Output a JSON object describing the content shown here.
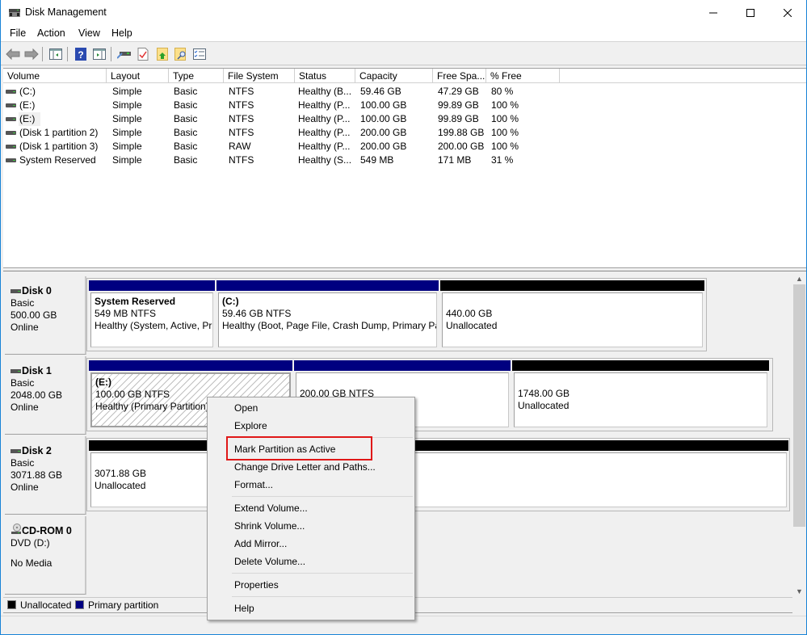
{
  "window": {
    "title": "Disk Management",
    "icon": "disk-management-icon",
    "controls": [
      "minimize",
      "maximize",
      "close"
    ]
  },
  "menubar": {
    "items": [
      {
        "label": "File"
      },
      {
        "label": "Action"
      },
      {
        "label": "View"
      },
      {
        "label": "Help"
      }
    ]
  },
  "toolbar": {
    "buttons": [
      {
        "icon": "back-arrow-icon"
      },
      {
        "icon": "forward-arrow-icon"
      },
      {
        "icon": "show-hide-console-tree-icon"
      },
      {
        "icon": "help-icon"
      },
      {
        "icon": "show-hide-action-pane-icon"
      },
      {
        "icon": "connect-drive-icon"
      },
      {
        "icon": "check-document-icon"
      },
      {
        "icon": "folder-up-icon"
      },
      {
        "icon": "folder-search-icon"
      },
      {
        "icon": "properties-list-icon"
      }
    ]
  },
  "volume_list": {
    "columns": [
      "Volume",
      "Layout",
      "Type",
      "File System",
      "Status",
      "Capacity",
      "Free Spa...",
      "% Free"
    ],
    "rows": [
      {
        "volume": " (C:)",
        "layout": "Simple",
        "type": "Basic",
        "fs": "NTFS",
        "status": "Healthy (B...",
        "capacity": "59.46 GB",
        "free": "47.29 GB",
        "pct": "80 %"
      },
      {
        "volume": " (E:)",
        "layout": "Simple",
        "type": "Basic",
        "fs": "NTFS",
        "status": "Healthy (P...",
        "capacity": "100.00 GB",
        "free": "99.89 GB",
        "pct": "100 %"
      },
      {
        "volume": " (E:)",
        "layout": "Simple",
        "type": "Basic",
        "fs": "NTFS",
        "status": "Healthy (P...",
        "capacity": "100.00 GB",
        "free": "99.89 GB",
        "pct": "100 %",
        "selected": true
      },
      {
        "volume": "(Disk 1 partition 2)",
        "layout": "Simple",
        "type": "Basic",
        "fs": "NTFS",
        "status": "Healthy (P...",
        "capacity": "200.00 GB",
        "free": "199.88 GB",
        "pct": "100 %"
      },
      {
        "volume": "(Disk 1 partition 3)",
        "layout": "Simple",
        "type": "Basic",
        "fs": "RAW",
        "status": "Healthy (P...",
        "capacity": "200.00 GB",
        "free": "200.00 GB",
        "pct": "100 %"
      },
      {
        "volume": "System Reserved",
        "layout": "Simple",
        "type": "Basic",
        "fs": "NTFS",
        "status": "Healthy (S...",
        "capacity": "549 MB",
        "free": "171 MB",
        "pct": "31 %"
      }
    ]
  },
  "disks": [
    {
      "name": "Disk 0",
      "type": "Basic",
      "size": "500.00 GB",
      "status": "Online",
      "partitions": [
        {
          "title": "System Reserved",
          "line1": "549 MB NTFS",
          "line2": "Healthy (System, Active, Pr",
          "kind": "primary"
        },
        {
          "title": " (C:)",
          "line1": "59.46 GB NTFS",
          "line2": "Healthy (Boot, Page File, Crash Dump, Primary Pa",
          "kind": "primary"
        },
        {
          "title": "",
          "line1": "440.00 GB",
          "line2": "Unallocated",
          "kind": "unallocated"
        }
      ]
    },
    {
      "name": "Disk 1",
      "type": "Basic",
      "size": "2048.00 GB",
      "status": "Online",
      "partitions": [
        {
          "title": " (E:)",
          "line1": "100.00 GB NTFS",
          "line2": "Healthy (Primary Partition)",
          "kind": "primary",
          "selected": true
        },
        {
          "title": "",
          "line1": "200.00 GB NTFS",
          "line2": "",
          "kind": "primary"
        },
        {
          "title": "",
          "line1": "1748.00 GB",
          "line2": "Unallocated",
          "kind": "unallocated"
        }
      ]
    },
    {
      "name": "Disk 2",
      "type": "Basic",
      "size": "3071.88 GB",
      "status": "Online",
      "partitions": [
        {
          "title": "",
          "line1": "3071.88 GB",
          "line2": "Unallocated",
          "kind": "unallocated"
        }
      ]
    },
    {
      "name": "CD-ROM 0",
      "type": "DVD (D:)",
      "size": "",
      "status": "No Media",
      "partitions": []
    }
  ],
  "legend": [
    {
      "label": "Unallocated",
      "color": "#000000"
    },
    {
      "label": "Primary partition",
      "color": "#000080"
    }
  ],
  "context_menu": {
    "items": [
      {
        "label": "Open"
      },
      {
        "label": "Explore"
      },
      {
        "separator": true
      },
      {
        "label": "Mark Partition as Active",
        "highlighted": true
      },
      {
        "label": "Change Drive Letter and Paths..."
      },
      {
        "label": "Format..."
      },
      {
        "separator": true
      },
      {
        "label": "Extend Volume..."
      },
      {
        "label": "Shrink Volume..."
      },
      {
        "label": "Add Mirror..."
      },
      {
        "label": "Delete Volume..."
      },
      {
        "separator": true
      },
      {
        "label": "Properties"
      },
      {
        "separator": true
      },
      {
        "label": "Help"
      }
    ]
  },
  "colors": {
    "primary_partition": "#000080",
    "unallocated": "#000000",
    "highlight_box": "#e01818",
    "window_border": "#1883d7"
  }
}
